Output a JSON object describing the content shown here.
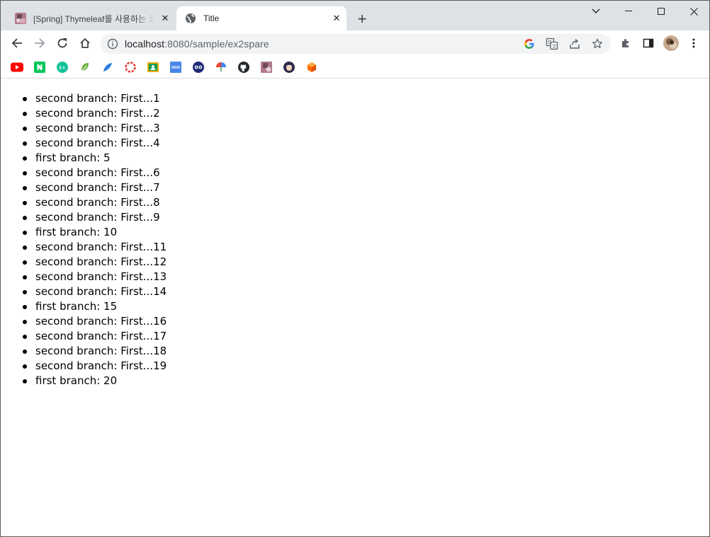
{
  "browser": {
    "tabs": [
      {
        "title": "[Spring] Thymeleaf를 사용하는 코드",
        "active": false,
        "favicon": "profile-image-favicon"
      },
      {
        "title": "Title",
        "active": true,
        "favicon": "globe-icon"
      }
    ],
    "address": {
      "host": "localhost",
      "rest": ":8080/sample/ex2spare"
    },
    "bookmarks": [
      "youtube-icon",
      "naver-icon",
      "grammarly-icon",
      "leaf-icon",
      "feather-icon",
      "lifebuoy-icon",
      "classroom-icon",
      "board-icon",
      "owl-icon",
      "umbrella-icon",
      "github-icon",
      "profile-icon",
      "character-icon",
      "cube-icon"
    ]
  },
  "page": {
    "items": [
      "second branch: First...1",
      "second branch: First...2",
      "second branch: First...3",
      "second branch: First...4",
      "first branch: 5",
      "second branch: First...6",
      "second branch: First...7",
      "second branch: First...8",
      "second branch: First...9",
      "first branch: 10",
      "second branch: First...11",
      "second branch: First...12",
      "second branch: First...13",
      "second branch: First...14",
      "first branch: 15",
      "second branch: First...16",
      "second branch: First...17",
      "second branch: First...18",
      "second branch: First...19",
      "first branch: 20"
    ]
  },
  "colors": {
    "tabstrip": "#dee1e6",
    "omnibox": "#f1f3f4",
    "text": "#000000"
  }
}
